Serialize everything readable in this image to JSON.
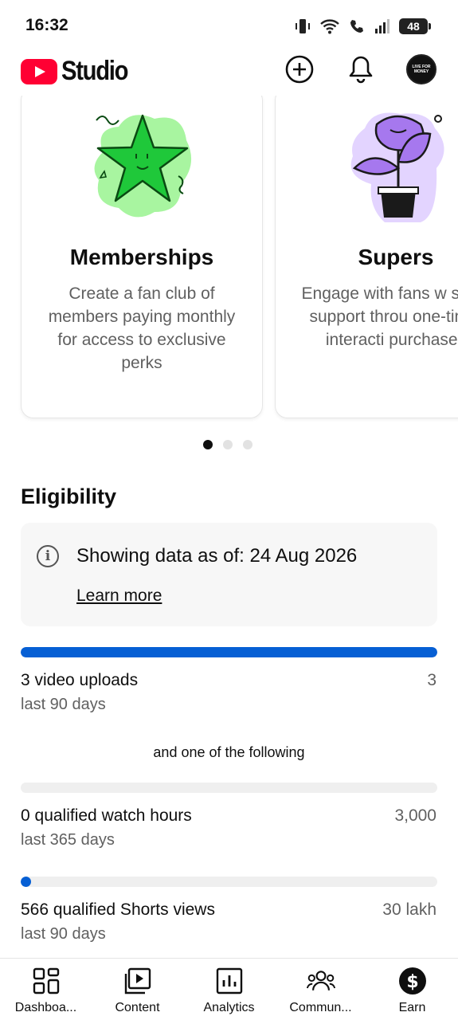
{
  "status_bar": {
    "time": "16:32",
    "battery": "48"
  },
  "header": {
    "logo_text": "Studio",
    "avatar_text": "LIVE FOR MONEY"
  },
  "cards": [
    {
      "title": "Memberships",
      "description": "Create a fan club of members paying monthly for access to exclusive perks",
      "art_icon": "star-icon"
    },
    {
      "title": "Supers",
      "description": "Engage with fans w show support throu one-time, interacti purchases",
      "art_icon": "plant-icon"
    }
  ],
  "carousel": {
    "total_pages": 3,
    "active_page": 1
  },
  "eligibility": {
    "title": "Eligibility",
    "info_text": "Showing data as of: 24 Aug 2026",
    "learn_more": "Learn more",
    "or_text": "and one of the following",
    "requirements": [
      {
        "label": "3 video uploads",
        "period": "last 90 days",
        "target": "3",
        "progress": 1.0
      },
      {
        "label": "0 qualified watch hours",
        "period": "last 365 days",
        "target": "3,000",
        "progress": 0.0
      },
      {
        "label": "566 qualified Shorts views",
        "period": "last 90 days",
        "target": "30 lakh",
        "progress": 0.0002
      }
    ]
  },
  "bottom_nav": [
    {
      "label": "Dashboa...",
      "icon": "dashboard-icon"
    },
    {
      "label": "Content",
      "icon": "content-icon"
    },
    {
      "label": "Analytics",
      "icon": "analytics-icon"
    },
    {
      "label": "Commun...",
      "icon": "community-icon"
    },
    {
      "label": "Earn",
      "icon": "earn-icon",
      "active": true
    }
  ],
  "colors": {
    "accent": "#065fd4",
    "brand": "#ff0033",
    "membership_green": "#1fc83a",
    "supers_purple": "#a678ee"
  }
}
